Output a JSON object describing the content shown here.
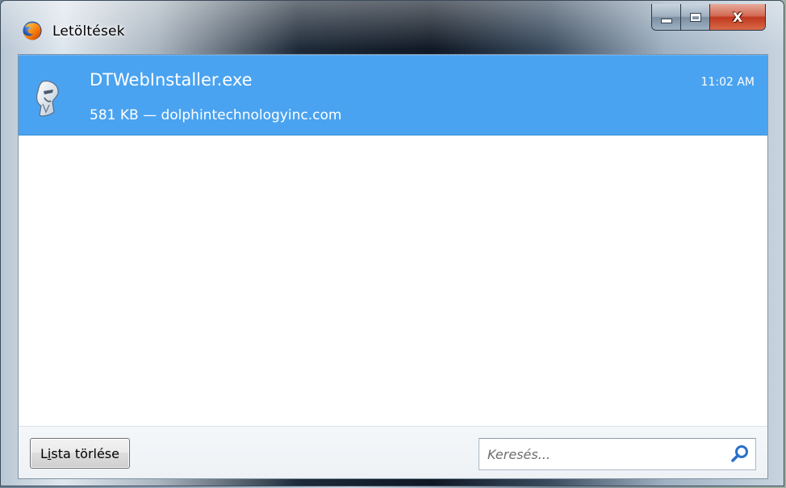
{
  "window": {
    "title": "Letöltések",
    "app_icon": "firefox-icon",
    "caption_buttons": {
      "minimize_icon": "minimize-icon",
      "maximize_icon": "maximize-icon",
      "close_label": "X"
    }
  },
  "downloads": [
    {
      "file_name": "DTWebInstaller.exe",
      "meta": "581 KB — dolphintechnologyinc.com",
      "time": "11:02 AM",
      "icon": "installer-file-icon",
      "selected": true
    }
  ],
  "toolbar": {
    "clear_button_accesskey_prefix": "L",
    "clear_button_accesskey_letter": "i",
    "clear_button_accesskey_suffix": "sta törlése",
    "search_placeholder": "Keresés...",
    "search_icon": "search-icon"
  },
  "colors": {
    "selection": "#4aa3f0",
    "close_button": "#c0391f"
  }
}
